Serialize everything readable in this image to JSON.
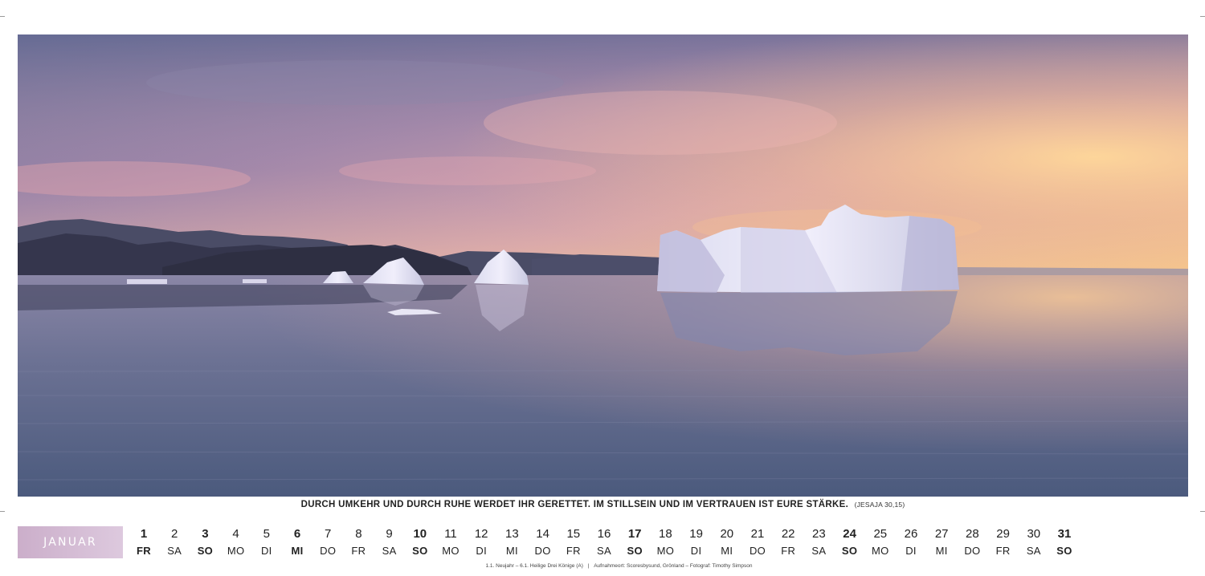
{
  "photo": {
    "subject": "icebergs-at-sunset",
    "colors": {
      "sky_top": "#6e7095",
      "sky_mid": "#b38fb0",
      "horizon_glow": "#f6c88f",
      "water": "#5d6789",
      "ice": "#e9e9f6",
      "mountains": "#3d3f58"
    }
  },
  "quote": {
    "text": "DURCH UMKEHR UND DURCH RUHE WERDET IHR GERETTET. IM STILLSEIN UND IM VERTRAUEN IST EURE STÄRKE.",
    "reference": "(JESAJA 30,15)"
  },
  "calendar": {
    "month": "JANUAR",
    "month_color": "#d3bad3",
    "days": [
      {
        "num": "1",
        "wd": "FR",
        "style": "hol"
      },
      {
        "num": "2",
        "wd": "SA",
        "style": ""
      },
      {
        "num": "3",
        "wd": "SO",
        "style": "sun"
      },
      {
        "num": "4",
        "wd": "MO",
        "style": ""
      },
      {
        "num": "5",
        "wd": "DI",
        "style": ""
      },
      {
        "num": "6",
        "wd": "MI",
        "style": "hol"
      },
      {
        "num": "7",
        "wd": "DO",
        "style": ""
      },
      {
        "num": "8",
        "wd": "FR",
        "style": ""
      },
      {
        "num": "9",
        "wd": "SA",
        "style": ""
      },
      {
        "num": "10",
        "wd": "SO",
        "style": "sun"
      },
      {
        "num": "11",
        "wd": "MO",
        "style": ""
      },
      {
        "num": "12",
        "wd": "DI",
        "style": ""
      },
      {
        "num": "13",
        "wd": "MI",
        "style": ""
      },
      {
        "num": "14",
        "wd": "DO",
        "style": ""
      },
      {
        "num": "15",
        "wd": "FR",
        "style": ""
      },
      {
        "num": "16",
        "wd": "SA",
        "style": ""
      },
      {
        "num": "17",
        "wd": "SO",
        "style": "sun"
      },
      {
        "num": "18",
        "wd": "MO",
        "style": ""
      },
      {
        "num": "19",
        "wd": "DI",
        "style": ""
      },
      {
        "num": "20",
        "wd": "MI",
        "style": ""
      },
      {
        "num": "21",
        "wd": "DO",
        "style": ""
      },
      {
        "num": "22",
        "wd": "FR",
        "style": ""
      },
      {
        "num": "23",
        "wd": "SA",
        "style": ""
      },
      {
        "num": "24",
        "wd": "SO",
        "style": "sun"
      },
      {
        "num": "25",
        "wd": "MO",
        "style": ""
      },
      {
        "num": "26",
        "wd": "DI",
        "style": ""
      },
      {
        "num": "27",
        "wd": "MI",
        "style": ""
      },
      {
        "num": "28",
        "wd": "DO",
        "style": ""
      },
      {
        "num": "29",
        "wd": "FR",
        "style": ""
      },
      {
        "num": "30",
        "wd": "SA",
        "style": ""
      },
      {
        "num": "31",
        "wd": "SO",
        "style": "sun"
      }
    ]
  },
  "footnote": {
    "holidays": "1.1. Neujahr – 6.1. Heilige Drei Könige (A)",
    "separator": "|",
    "location": "Aufnahmeort: Scoresbysund, Grönland – Fotograf: Timothy Simpson"
  }
}
